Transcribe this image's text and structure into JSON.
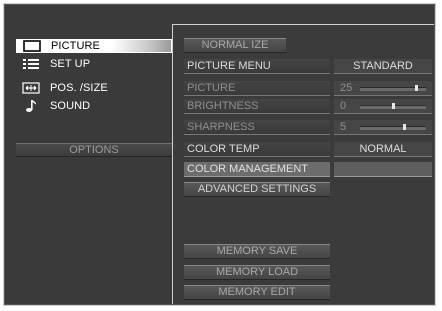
{
  "left_menu": {
    "items": [
      {
        "label": "PICTURE",
        "icon": "picture-frame-icon",
        "selected": true
      },
      {
        "label": "SET UP",
        "icon": "list-icon",
        "selected": false
      },
      {
        "label": "POS. /SIZE",
        "icon": "resize-arrows-icon",
        "selected": false
      },
      {
        "label": "SOUND",
        "icon": "music-note-icon",
        "selected": false
      }
    ],
    "options_label": "OPTIONS"
  },
  "panel": {
    "normalize_label": "NORMAL IZE",
    "picture_menu": {
      "label": "PICTURE MENU",
      "value": "STANDARD"
    },
    "picture": {
      "label": "PICTURE",
      "value": "25",
      "level": 0.88
    },
    "brightness": {
      "label": "BRIGHTNESS",
      "value": "0",
      "level": 0.5
    },
    "sharpness": {
      "label": "SHARPNESS",
      "value": "5",
      "level": 0.68
    },
    "color_temp": {
      "label": "COLOR TEMP",
      "value": "NORMAL"
    },
    "color_management": {
      "label": "COLOR MANAGEMENT"
    },
    "advanced_settings_label": "ADVANCED SETTINGS",
    "memory_save_label": "MEMORY SAVE",
    "memory_load_label": "MEMORY LOAD",
    "memory_edit_label": "MEMORY EDIT"
  }
}
